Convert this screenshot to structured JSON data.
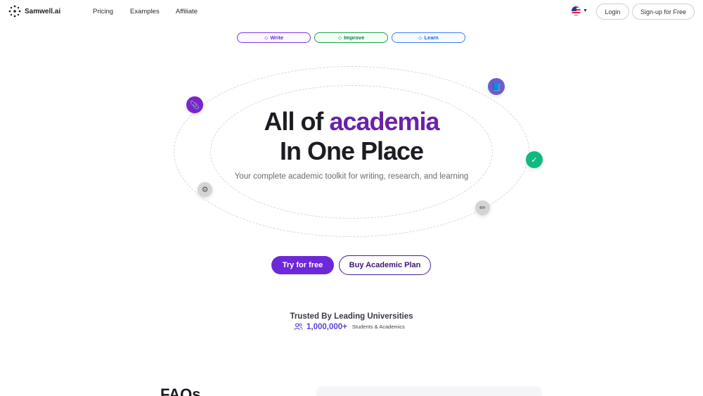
{
  "nav": {
    "brand": "Samwell.ai",
    "links": [
      "Pricing",
      "Examples",
      "Affiliate"
    ],
    "language_icon": "us-flag-icon",
    "login": "Login",
    "signup": "Sign-up for Free"
  },
  "pills": [
    {
      "label": "Write",
      "color": "#6d28d9"
    },
    {
      "label": "Improve",
      "color": "#15803d"
    },
    {
      "label": "Learn",
      "color": "#2563eb"
    }
  ],
  "hero": {
    "title_prefix": "All of",
    "title_accent": "academia",
    "title_line2": "In One Place",
    "subtitle": "Your complete academic toolkit for writing, research, and learning"
  },
  "floating_icons": [
    {
      "name": "paperclip-icon",
      "glyph": "📎",
      "color": "#7e22ce"
    },
    {
      "name": "book-icon",
      "glyph": "📘",
      "color": "#6d5bd0"
    },
    {
      "name": "checkmark-icon",
      "glyph": "✓",
      "color": "#10b981"
    },
    {
      "name": "settings-icon",
      "glyph": "⚙",
      "color": "#d4d4d8"
    },
    {
      "name": "pencil-icon",
      "glyph": "✏",
      "color": "#d4d4d8"
    }
  ],
  "cta": {
    "primary": "Try for free",
    "secondary": "Buy Academic Plan"
  },
  "trust": {
    "title": "Trusted By Leading Universities",
    "count": "1,000,000+",
    "label": "Students & Academics"
  },
  "faq": {
    "heading": "FAQs"
  },
  "colors": {
    "brand": "#6d28d9",
    "accent_text": "#6b21a8"
  }
}
